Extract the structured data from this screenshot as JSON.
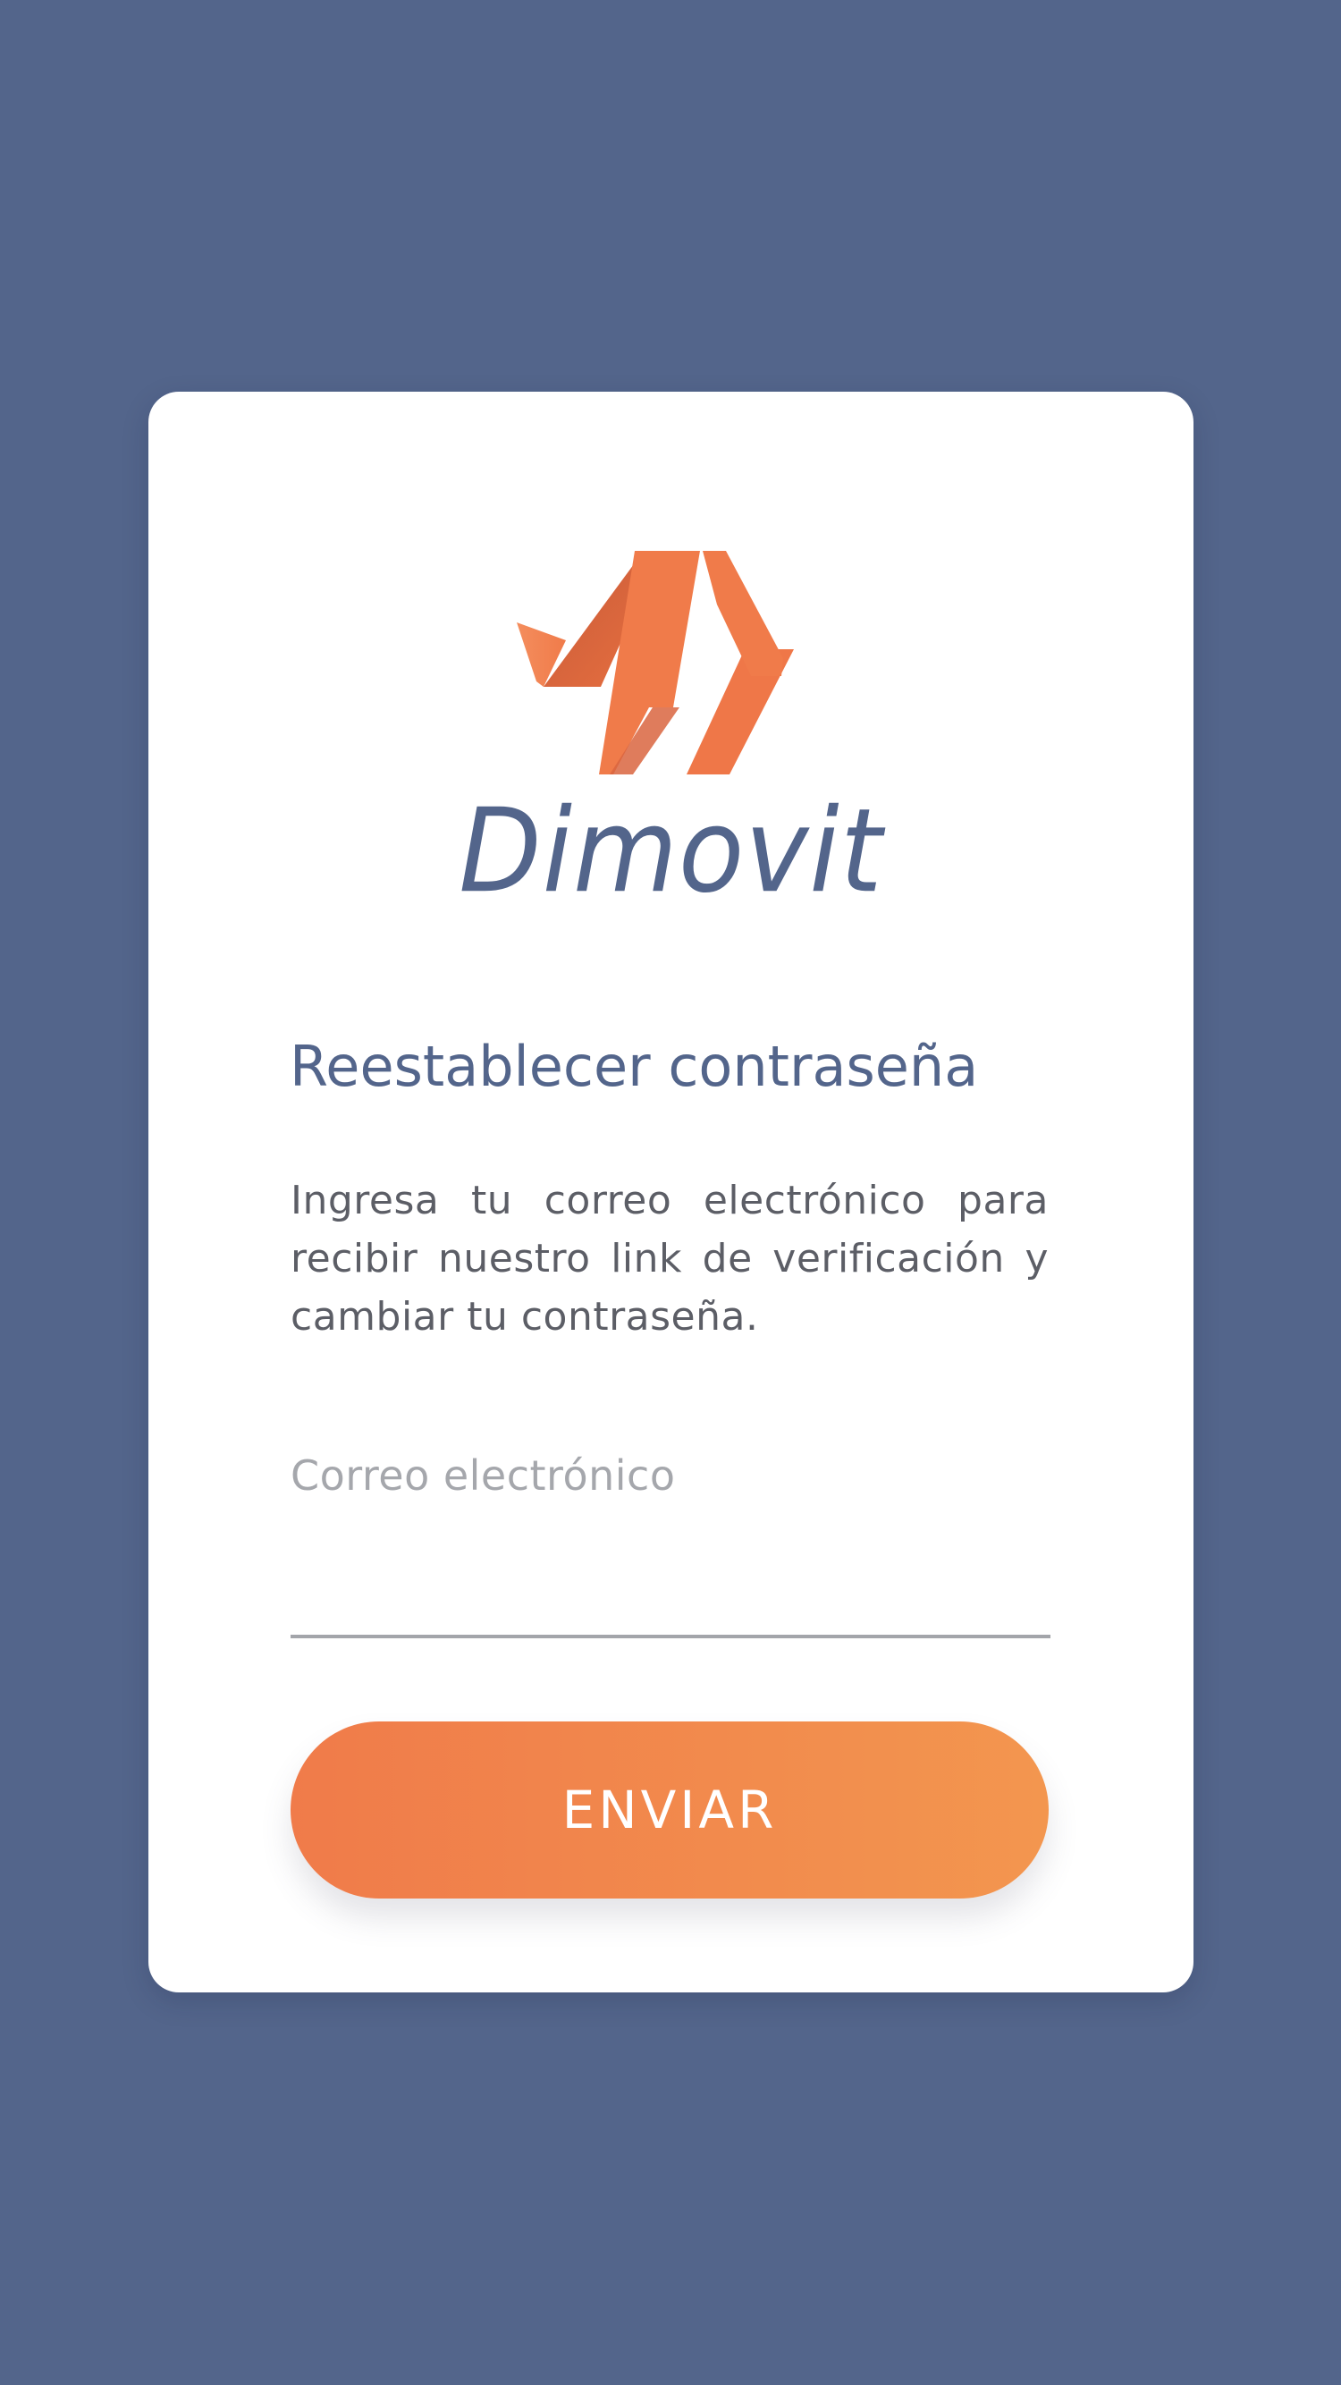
{
  "brand": {
    "name": "Dimovit",
    "logo_icon": "dimovit-logo-mark",
    "primary_color": "#f07b4a",
    "secondary_color": "#f3964f",
    "text_color": "#53658b"
  },
  "screen": {
    "title": "Reestablecer contraseña",
    "description": "Ingresa tu correo electrónico para recibir nuestro link de verificación y cambiar tu contraseña."
  },
  "form": {
    "email_label": "Correo electrónico",
    "email_value": "",
    "submit_label": "ENVIAR"
  }
}
